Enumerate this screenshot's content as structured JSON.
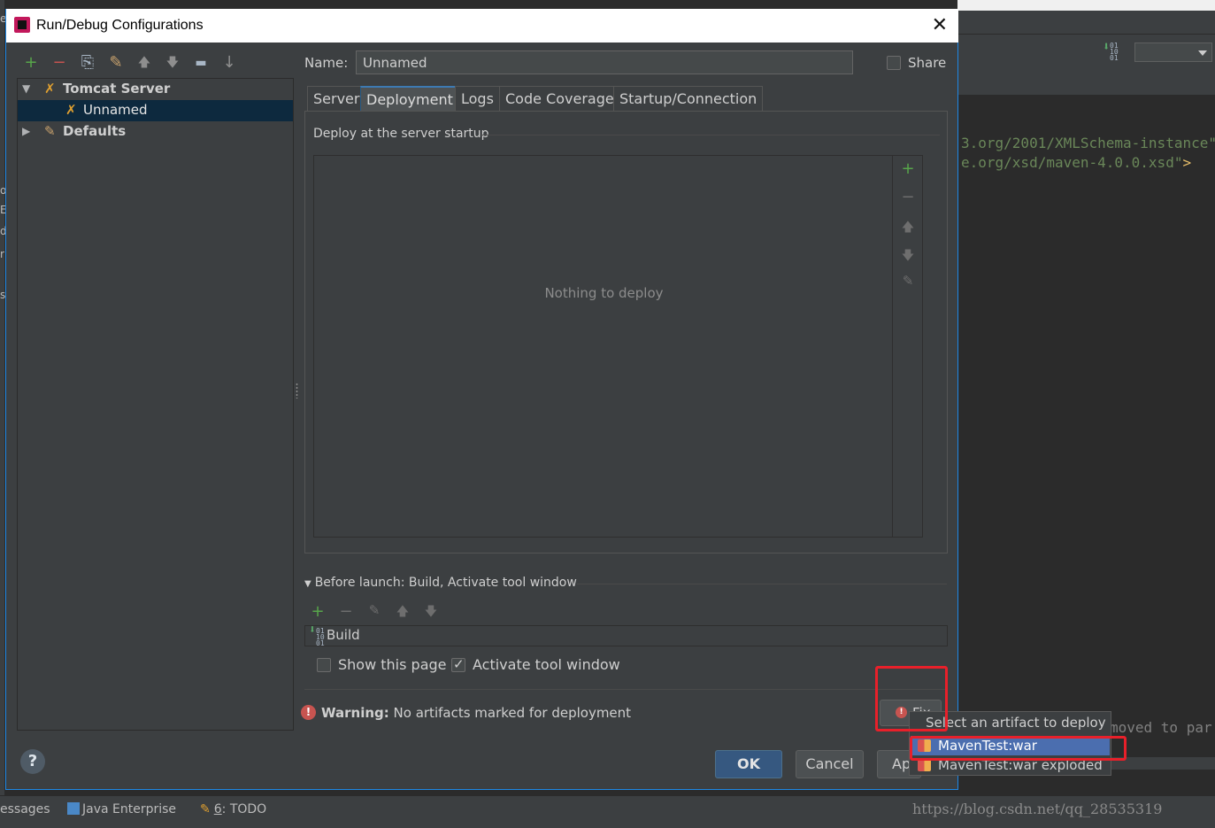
{
  "ide": {
    "left_letters": [
      "e",
      "o",
      "E",
      "d",
      "r",
      "s"
    ],
    "editor_line1": "3.org/2001/XMLSchema-instance\"",
    "editor_line2_text": "e.org/xsd/maven-4.0.0.xsd\"",
    "editor_line2_end": ">",
    "editor_line3": "moved to par",
    "bottom_tools": {
      "messages": "essages",
      "java_enterprise": "Java Enterprise",
      "todo_number": "6",
      "todo_label": ": TODO"
    },
    "watermark": "https://blog.csdn.net/qq_28535319"
  },
  "dialog": {
    "title": "Run/Debug Configurations",
    "toolbar": {
      "add": "+",
      "remove": "−",
      "copy": "⎘",
      "edit_defaults": "✎",
      "move_up": "🡅",
      "move_down": "🡇",
      "folder": "▬",
      "sort": "↓"
    },
    "tree": {
      "tomcat_server": "Tomcat Server",
      "unnamed": "Unnamed",
      "defaults": "Defaults"
    },
    "name_label": "Name:",
    "name_value": "Unnamed",
    "share_label": "Share",
    "tabs": [
      "Server",
      "Deployment",
      "Logs",
      "Code Coverage",
      "Startup/Connection"
    ],
    "active_tab": "Deployment",
    "deploy_group_title": "Deploy at the server startup",
    "deploy_empty": "Nothing to deploy",
    "before_launch_header": "Before launch: Build, Activate tool window",
    "before_launch_items": [
      "Build"
    ],
    "show_page_label": "Show this page",
    "activate_tool_label": "Activate tool window",
    "warning_bold": "Warning:",
    "warning_text": " No artifacts marked for deployment",
    "fix_label": "Fix",
    "help": "?",
    "ok": "OK",
    "cancel": "Cancel",
    "apply": "Ap"
  },
  "popup": {
    "title": "Select an artifact to deploy",
    "items": [
      "MavenTest:war",
      "MavenTest:war exploded"
    ],
    "selected": "MavenTest:war"
  },
  "colors": {
    "dialog_bg": "#3c3f41",
    "selection": "#4b6eaf",
    "annotation": "#e8202a",
    "ok_button": "#365880"
  }
}
